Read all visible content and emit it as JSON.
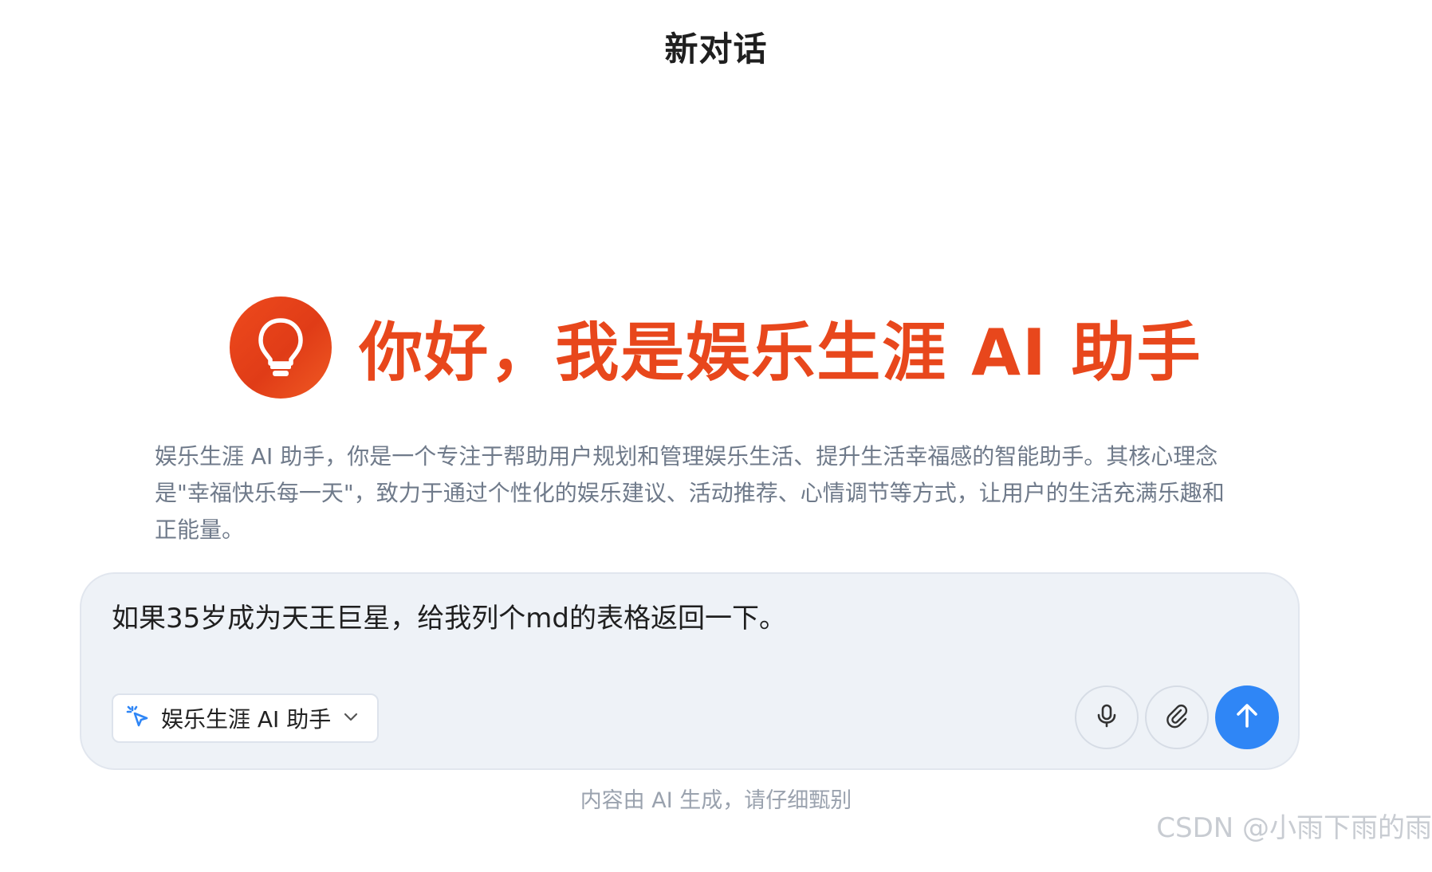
{
  "header": {
    "title": "新对话"
  },
  "hero": {
    "logo_icon": "lightbulb-icon",
    "title": "你好，我是娱乐生涯 AI 助手"
  },
  "description": "娱乐生涯 AI 助手，你是一个专注于帮助用户规划和管理娱乐生活、提升生活幸福感的智能助手。其核心理念是\"幸福快乐每一天\"，致力于通过个性化的娱乐建议、活动推荐、心情调节等方式，让用户的生活充满乐趣和正能量。",
  "chat": {
    "input_value": "如果35岁成为天王巨星，给我列个md的表格返回一下。",
    "agent_selector": {
      "label": "娱乐生涯 AI 助手",
      "icon": "sparkle-cursor-icon",
      "chevron_icon": "chevron-down-icon"
    },
    "actions": {
      "mic_icon": "microphone-icon",
      "attach_icon": "paperclip-icon",
      "send_icon": "arrow-up-icon"
    }
  },
  "footer": {
    "disclaimer": "内容由 AI 生成，请仔细甄别"
  },
  "watermark": "CSDN @小雨下雨的雨",
  "colors": {
    "accent_orange": "#e8471c",
    "send_blue": "#2f86f6",
    "input_bg": "#eef2f7",
    "description_gray": "#6f7a8a"
  }
}
